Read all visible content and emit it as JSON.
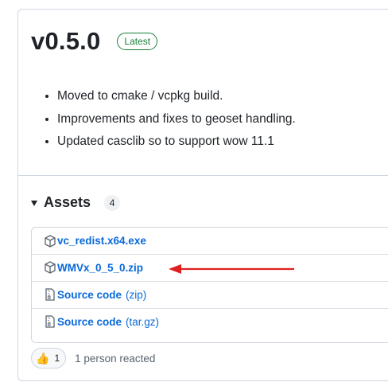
{
  "release": {
    "version": "v0.5.0",
    "badge": "Latest",
    "notes": [
      "Moved to cmake / vcpkg build.",
      "Improvements and fixes to geoset handling.",
      "Updated casclib so to support wow 11.1"
    ]
  },
  "assets": {
    "label": "Assets",
    "count": "4",
    "items": [
      {
        "name": "vc_redist.x64.exe",
        "ext": "",
        "icon": "package-icon"
      },
      {
        "name": "WMVx_0_5_0.zip",
        "ext": "",
        "icon": "package-icon"
      },
      {
        "name": "Source code",
        "ext": "(zip)",
        "icon": "file-zip-icon"
      },
      {
        "name": "Source code",
        "ext": "(tar.gz)",
        "icon": "file-zip-icon"
      }
    ]
  },
  "reactions": {
    "emoji": "👍",
    "count": "1",
    "summary": "1 person reacted"
  },
  "colors": {
    "link": "#0969da",
    "latest_badge": "#1a7f37",
    "annotation_arrow": "#e02020"
  }
}
